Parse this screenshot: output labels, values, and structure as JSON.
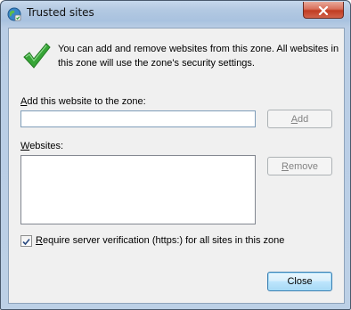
{
  "window": {
    "title": "Trusted sites",
    "icon": "globe-icon",
    "close_icon": "close-icon"
  },
  "info": {
    "icon": "green-checkmark-icon",
    "text": "You can add and remove websites from this zone. All websites in this zone will use the zone's security settings."
  },
  "add_site": {
    "label_accel": "A",
    "label_rest": "dd this website to the zone:",
    "input_value": "",
    "button_accel": "A",
    "button_rest": "dd",
    "button_enabled": false
  },
  "websites": {
    "label_accel": "W",
    "label_rest": "ebsites:",
    "items": [],
    "remove_accel": "R",
    "remove_rest": "emove",
    "remove_enabled": false
  },
  "require_https": {
    "checked": true,
    "label_accel": "R",
    "label_rest": "equire server verification (https:) for all sites in this zone"
  },
  "footer": {
    "close_label": "Close"
  },
  "colors": {
    "accent_check": "#2ea02e",
    "close_button_red": "#c03c22",
    "default_button_border": "#3c7fb1"
  }
}
